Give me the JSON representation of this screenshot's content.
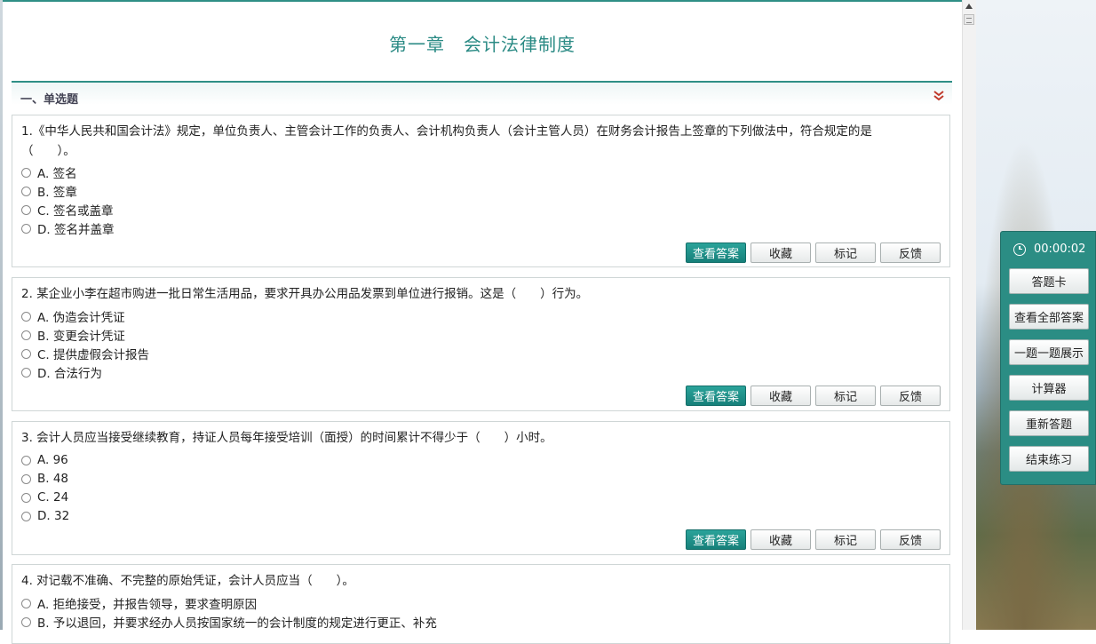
{
  "page_title": "第一章　会计法律制度",
  "section": {
    "title": "一、单选题"
  },
  "buttons": {
    "view_answer": "查看答案",
    "favorite": "收藏",
    "mark": "标记",
    "feedback": "反馈"
  },
  "questions": [
    {
      "text": "1.《中华人民共和国会计法》规定，单位负责人、主管会计工作的负责人、会计机构负责人（会计主管人员）在财务会计报告上签章的下列做法中，符合规定的是（　　）。",
      "options": [
        "A. 签名",
        "B. 签章",
        "C. 签名或盖章",
        "D. 签名并盖章"
      ]
    },
    {
      "text": "2. 某企业小李在超市购进一批日常生活用品，要求开具办公用品发票到单位进行报销。这是（　　）行为。",
      "options": [
        "A. 伪造会计凭证",
        "B. 变更会计凭证",
        "C. 提供虚假会计报告",
        "D. 合法行为"
      ]
    },
    {
      "text": "3. 会计人员应当接受继续教育，持证人员每年接受培训（面授）的时间累计不得少于（　　）小时。",
      "options": [
        "A. 96",
        "B. 48",
        "C. 24",
        "D. 32"
      ]
    },
    {
      "text": "4. 对记载不准确、不完整的原始凭证，会计人员应当（　　）。",
      "options": [
        "A. 拒绝接受，并报告领导，要求查明原因",
        "B. 予以退回，并要求经办人员按国家统一的会计制度的规定进行更正、补充"
      ]
    }
  ],
  "side_panel": {
    "timer": "00:00:02",
    "buttons": [
      "答题卡",
      "查看全部答案",
      "一题一题展示",
      "计算器",
      "重新答题",
      "结束练习"
    ]
  },
  "colors": {
    "accent": "#2b8d84",
    "title": "#2a8a84",
    "collapse": "#c0392b"
  },
  "icons": {
    "timer": "clock-icon",
    "section_toggle": "double-chevron-down-icon"
  }
}
